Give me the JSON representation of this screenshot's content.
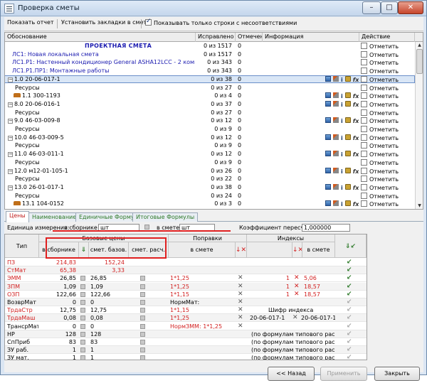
{
  "window": {
    "title": "Проверка сметы",
    "minimize": "–",
    "maximize": "□",
    "close": "✕"
  },
  "toolbar": {
    "show_report": "Показать отчет",
    "set_bookmarks": "Установить закладки в смете",
    "only_mismatch_label": "Показывать только строки с несоответствиями",
    "only_mismatch_checked": true
  },
  "grid1": {
    "headers": {
      "name": "Обоснование",
      "fixed": "Исправлено",
      "marked": "Отмечено",
      "info": "Информация",
      "action": "Действие"
    },
    "rows": [
      {
        "name": "ПРОЕКТНАЯ СМЕТА",
        "kind": "title",
        "fixed": "0 из 1517",
        "marked": "0",
        "action": "Отметить"
      },
      {
        "name": "ЛС1: Новая локальная смета",
        "kind": "blue",
        "fixed": "0 из 1517",
        "marked": "0",
        "action": "Отметить"
      },
      {
        "name": "ЛС1.Р1: Настенный кондиционер General ASHA12LCC - 2 комплекта",
        "kind": "blue",
        "fixed": "0 из 343",
        "marked": "0",
        "action": "Отметить"
      },
      {
        "name": "ЛС1.Р1.ПР1: Монтажные работы",
        "kind": "blue",
        "fixed": "0 из 343",
        "marked": "0",
        "action": "Отметить"
      },
      {
        "name": "1.0   20-06-017-1",
        "kind": "node",
        "fixed": "0 из 38",
        "marked": "0",
        "icons": true,
        "action": "Отметить",
        "selected": true
      },
      {
        "name": "Ресурсы",
        "kind": "res",
        "fixed": "0 из 27",
        "marked": "0",
        "action": "Отметить"
      },
      {
        "name": "1.1   300-1193",
        "kind": "leaf",
        "fixed": "0 из 4",
        "marked": "0",
        "icons": true,
        "action": "Отметить"
      },
      {
        "name": "8.0   20-06-016-1",
        "kind": "node",
        "fixed": "0 из 37",
        "marked": "0",
        "icons": true,
        "action": "Отметить"
      },
      {
        "name": "Ресурсы",
        "kind": "res",
        "fixed": "0 из 27",
        "marked": "0",
        "action": "Отметить"
      },
      {
        "name": "9.0   46-03-009-8",
        "kind": "node",
        "fixed": "0 из 12",
        "marked": "0",
        "icons": true,
        "action": "Отметить"
      },
      {
        "name": "Ресурсы",
        "kind": "res",
        "fixed": "0 из 9",
        "marked": "0",
        "action": "Отметить"
      },
      {
        "name": "10.0   46-03-009-5",
        "kind": "node",
        "fixed": "0 из 12",
        "marked": "0",
        "icons": true,
        "action": "Отметить"
      },
      {
        "name": "Ресурсы",
        "kind": "res",
        "fixed": "0 из 9",
        "marked": "0",
        "action": "Отметить"
      },
      {
        "name": "11.0   46-03-011-1",
        "kind": "node",
        "fixed": "0 из 12",
        "marked": "0",
        "icons": true,
        "action": "Отметить"
      },
      {
        "name": "Ресурсы",
        "kind": "res",
        "fixed": "0 из 9",
        "marked": "0",
        "action": "Отметить"
      },
      {
        "name": "12.0   м12-01-105-1",
        "kind": "node",
        "fixed": "0 из 26",
        "marked": "0",
        "icons": true,
        "action": "Отметить"
      },
      {
        "name": "Ресурсы",
        "kind": "res",
        "fixed": "0 из 22",
        "marked": "0",
        "action": "Отметить"
      },
      {
        "name": "13.0   26-01-017-1",
        "kind": "node",
        "fixed": "0 из 38",
        "marked": "0",
        "icons": true,
        "action": "Отметить"
      },
      {
        "name": "Ресурсы",
        "kind": "res",
        "fixed": "0 из 24",
        "marked": "0",
        "action": "Отметить"
      },
      {
        "name": "13.1   104-0152",
        "kind": "leaf",
        "fixed": "0 из 3",
        "marked": "0",
        "icons": true,
        "action": "Отметить"
      }
    ]
  },
  "tabs": [
    "Цены",
    "Наименование",
    "Единичные Формулы",
    "Итоговые Формулы"
  ],
  "unit_row": {
    "label": "Единица измерения:",
    "in_collection": "в сборнике",
    "unit1": "шт",
    "in_estimate": "в смете",
    "unit2": "шт",
    "coef_label": "Коэффициент пересчета",
    "coef_value": "1,000000"
  },
  "grid2": {
    "headers": {
      "type": "Тип",
      "base": "Базовые цены",
      "in_collection": "в сборнике",
      "smet_base": "смет. базов.",
      "smet_calc": "смет. расч.",
      "corrections": "Поправки",
      "in_estimate": "в смете",
      "indexes": "Индексы",
      "idx_in_estimate": "в смете"
    },
    "rows": [
      {
        "type": "ПЗ",
        "type_color": "red",
        "base": "214,83",
        "smet": "152,24",
        "rowcolor": "red"
      },
      {
        "type": "СтМат",
        "type_color": "red",
        "base": "65,38",
        "smet": "3,33",
        "rowcolor": "red"
      },
      {
        "type": "ЭММ",
        "type_color": "red",
        "base": "26,85",
        "smet": "26,85",
        "corr": "1*1,25",
        "idx1": "1",
        "idx2": "5,06",
        "corrcolor": "red",
        "idxcolor": "red"
      },
      {
        "type": "ЗПМ",
        "type_color": "red",
        "base": "1,09",
        "smet": "1,09",
        "corr": "1*1,25",
        "idx1": "1",
        "idx2": "18,57",
        "corrcolor": "red",
        "idxcolor": "red"
      },
      {
        "type": "ОЗП",
        "type_color": "red",
        "base": "122,66",
        "smet": "122,66",
        "corr": "1*1,15",
        "idx1": "1",
        "idx2": "18,57",
        "corrcolor": "red",
        "idxcolor": "red"
      },
      {
        "type": "ВозврМат",
        "type_color": "black",
        "base": "0",
        "smet": "0",
        "corr": "НормМат:",
        "corrcolor": "black"
      },
      {
        "type": "ТрдаСтр",
        "type_color": "red",
        "base": "12,75",
        "smet": "12,75",
        "corr": "1*1,15",
        "idx_text": "Шифр индекса",
        "corrcolor": "red"
      },
      {
        "type": "ТрдаМаш",
        "type_color": "red",
        "base": "0,08",
        "smet": "0,08",
        "corr": "1*1,25",
        "idx_a": "20-06-017-1",
        "idx_b": "20-06-017-1",
        "corrcolor": "red"
      },
      {
        "type": "ТрансрМат",
        "type_color": "black",
        "base": "0",
        "smet": "0",
        "corr": "НормЗММ: 1*1,25",
        "corrcolor": "red"
      },
      {
        "type": "НР",
        "type_color": "black",
        "base": "128",
        "smet": "128",
        "note": "(по формулам типового расчета)"
      },
      {
        "type": "СпПриб",
        "type_color": "black",
        "base": "83",
        "smet": "83",
        "note": "(по формулам типового расчета)"
      },
      {
        "type": "ЗУ раб.",
        "type_color": "black",
        "base": "1",
        "smet": "1",
        "note": "(по формулам типового расчета)"
      },
      {
        "type": "ЗУ мат.",
        "type_color": "black",
        "base": "1",
        "smet": "1",
        "note": "(по формулам типового расчета)"
      }
    ]
  },
  "buttons": {
    "back": "<< Назад",
    "apply": "Применить",
    "close": "Закрыть"
  }
}
